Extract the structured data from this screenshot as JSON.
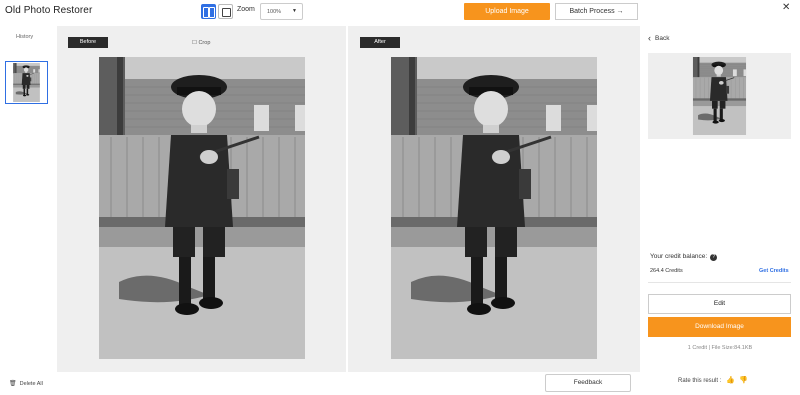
{
  "app": {
    "title": "Old Photo Restorer"
  },
  "toolbar": {
    "zoom_label": "Zoom",
    "zoom_value": "100%",
    "upload_label": "Upload Image",
    "batch_label": "Batch Process →",
    "close_glyph": "✕"
  },
  "history": {
    "label": "History",
    "delete_all_label": "Delete All",
    "trash_glyph": "🗑"
  },
  "compare": {
    "before_label": "Before",
    "after_label": "After",
    "crop_label": "☐ Crop",
    "feedback_label": "Feedback"
  },
  "side": {
    "back_label": "Back",
    "back_glyph": "‹",
    "credit_label": "Your credit balance:",
    "info_glyph": "?",
    "credit_value": "264.4 Credits",
    "get_credits_label": "Get Credits",
    "edit_label": "Edit",
    "download_label": "Download Image",
    "credit_info": "1 Credit | File Size:84.1KB",
    "rate_label": "Rate this result :",
    "thumb_up": "👍",
    "thumb_down": "👎"
  },
  "colors": {
    "accent_orange": "#f7941d",
    "accent_blue": "#2f6fe3",
    "tag_dark": "#2b2b2b"
  },
  "icons": [
    "view-split-icon",
    "view-single-icon",
    "chevron-down-icon",
    "close-icon",
    "trash-icon",
    "crop-icon",
    "back-chevron-icon",
    "info-icon",
    "thumbs-up-icon",
    "thumbs-down-icon"
  ]
}
